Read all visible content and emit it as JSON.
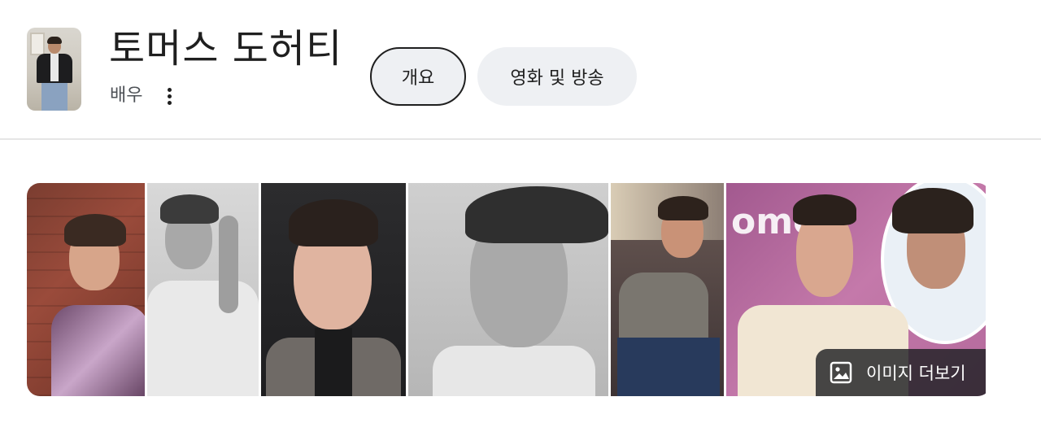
{
  "entity": {
    "name": "토머스 도허티",
    "type_label": "배우"
  },
  "tabs": [
    {
      "label": "개요",
      "active": true
    },
    {
      "label": "영화 및 방송",
      "active": false
    }
  ],
  "gallery": {
    "more_images_label": "이미지 더보기",
    "image_count": 6
  },
  "colors": {
    "chip_background": "#eef0f3",
    "text_primary": "#1f1f1f",
    "text_secondary": "#4d5156",
    "overlay": "#202124"
  },
  "icons": {
    "more": "more-vert-icon",
    "images": "image-icon"
  }
}
